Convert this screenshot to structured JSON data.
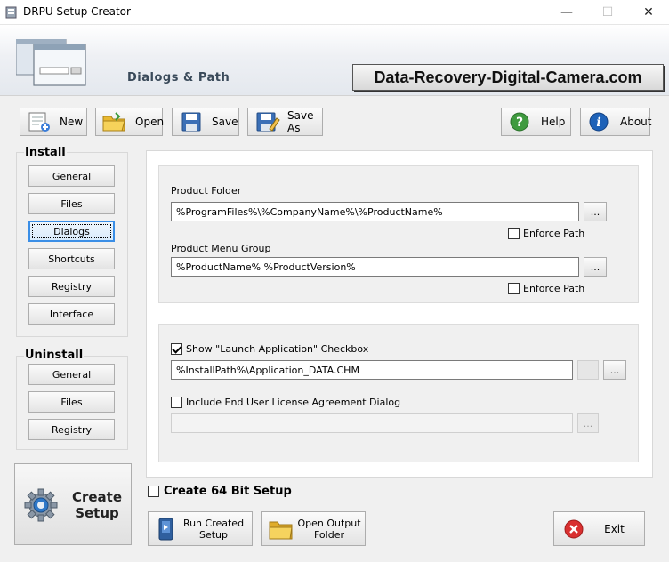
{
  "window": {
    "title": "DRPU Setup Creator",
    "minimize": "—",
    "maximize": "☐",
    "close": "✕"
  },
  "header": {
    "section_title": "Dialogs & Path",
    "brand": "Data-Recovery-Digital-Camera.com"
  },
  "toolbar": {
    "new": "New",
    "open": "Open",
    "save": "Save",
    "save_as": "Save As",
    "help": "Help",
    "about": "About"
  },
  "install": {
    "label": "Install",
    "items": [
      "General",
      "Files",
      "Dialogs",
      "Shortcuts",
      "Registry",
      "Interface"
    ],
    "active": "Dialogs"
  },
  "uninstall": {
    "label": "Uninstall",
    "items": [
      "General",
      "Files",
      "Registry"
    ]
  },
  "paths": {
    "product_folder_label": "Product Folder",
    "product_folder_value": "%ProgramFiles%\\%CompanyName%\\%ProductName%",
    "enforce_path_label": "Enforce Path",
    "enforce_path_1": false,
    "menu_group_label": "Product Menu Group",
    "menu_group_value": "%ProductName% %ProductVersion%",
    "enforce_path_2": false,
    "browse": "..."
  },
  "launch": {
    "show_launch_label": "Show \"Launch Application\" Checkbox",
    "show_launch_checked": true,
    "launch_path": "%InstallPath%\\Application_DATA.CHM",
    "eula_label": "Include End User License Agreement Dialog",
    "eula_checked": false,
    "eula_path": ""
  },
  "bottom": {
    "create_64_label": "Create 64 Bit Setup",
    "create_64_checked": false,
    "create_setup_line1": "Create",
    "create_setup_line2": "Setup",
    "run_line1": "Run Created",
    "run_line2": "Setup",
    "open_output_line1": "Open Output",
    "open_output_line2": "Folder",
    "exit": "Exit"
  },
  "colors": {
    "accent": "#3a8ee6",
    "help": "#3f9a3f",
    "about": "#1e62b8",
    "exit": "#d93030"
  }
}
